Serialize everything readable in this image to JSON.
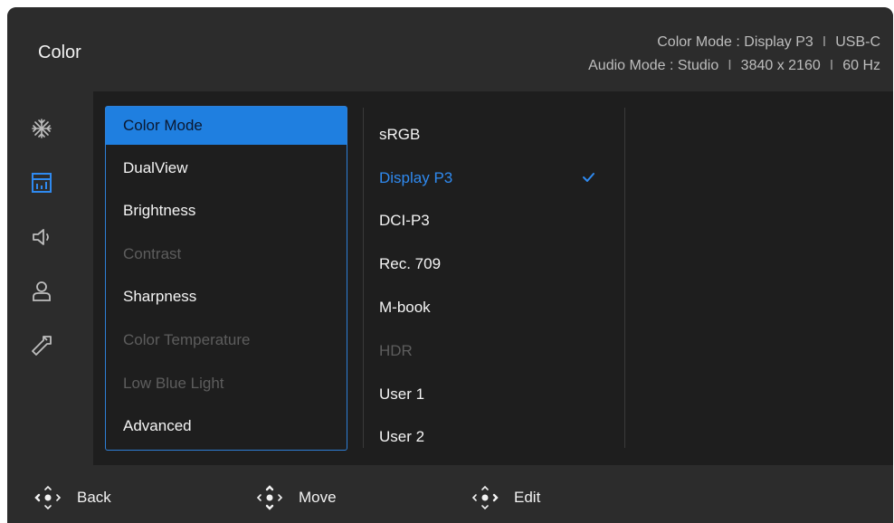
{
  "header": {
    "title": "Color",
    "color_mode_label": "Color Mode : Display P3",
    "input_label": "USB-C",
    "audio_mode_label": "Audio Mode : Studio",
    "resolution": "3840 x 2160",
    "refresh_rate": "60 Hz",
    "separator": "I"
  },
  "sidebar": {
    "items": [
      {
        "icon": "sparkle-icon",
        "selected": false
      },
      {
        "icon": "display-chart-icon",
        "selected": true
      },
      {
        "icon": "speaker-icon",
        "selected": false
      },
      {
        "icon": "user-icon",
        "selected": false
      },
      {
        "icon": "wrench-icon",
        "selected": false
      }
    ]
  },
  "menu": {
    "items": [
      {
        "label": "Color Mode",
        "state": "selected"
      },
      {
        "label": "DualView",
        "state": "normal"
      },
      {
        "label": "Brightness",
        "state": "normal"
      },
      {
        "label": "Contrast",
        "state": "disabled"
      },
      {
        "label": "Sharpness",
        "state": "normal"
      },
      {
        "label": "Color Temperature",
        "state": "disabled"
      },
      {
        "label": "Low Blue Light",
        "state": "disabled"
      },
      {
        "label": "Advanced",
        "state": "normal"
      }
    ]
  },
  "options": {
    "items": [
      {
        "label": "sRGB",
        "state": "normal"
      },
      {
        "label": "Display P3",
        "state": "active",
        "checked": true
      },
      {
        "label": "DCI-P3",
        "state": "normal"
      },
      {
        "label": "Rec. 709",
        "state": "normal"
      },
      {
        "label": "M-book",
        "state": "normal"
      },
      {
        "label": "HDR",
        "state": "disabled"
      },
      {
        "label": "User 1",
        "state": "normal"
      },
      {
        "label": "User 2",
        "state": "normal"
      }
    ]
  },
  "footer": {
    "back_label": "Back",
    "move_label": "Move",
    "edit_label": "Edit"
  },
  "colors": {
    "accent": "#1f7fe0",
    "active_text": "#2f8af0",
    "disabled_text": "#5d5d5d",
    "panel_bg": "#2c2c2c",
    "content_bg": "#1e1e1e"
  }
}
